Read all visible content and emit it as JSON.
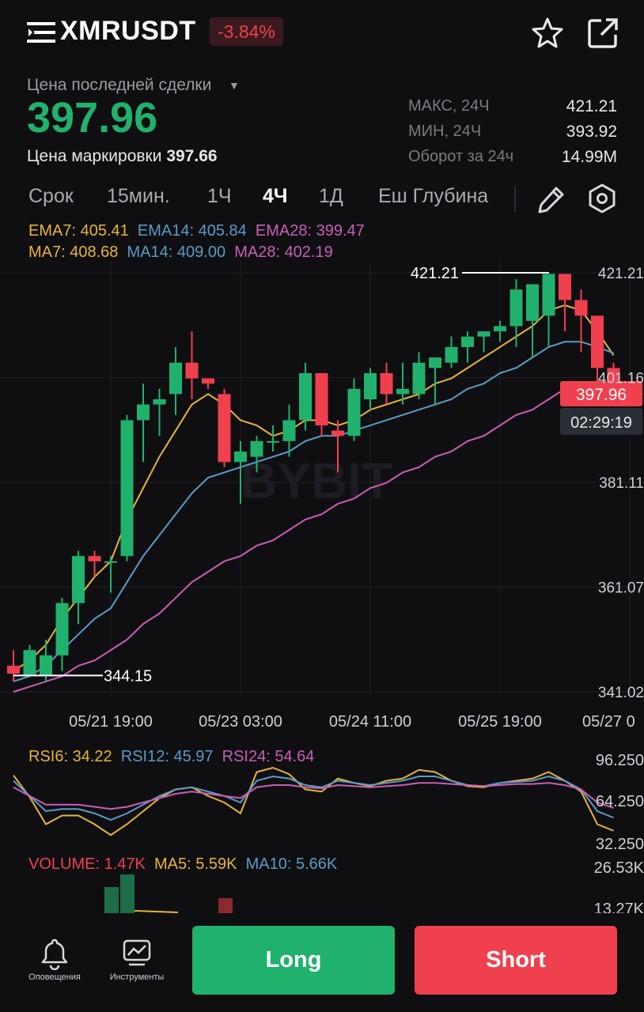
{
  "header": {
    "symbol": "XMRUSDT",
    "change": "-3.84%",
    "icons": [
      "menu-icon",
      "star-icon",
      "share-icon"
    ]
  },
  "price": {
    "label": "Цена последней сделки",
    "last": "397.96",
    "mark_label": "Цена маркировки",
    "mark_value": "397.66"
  },
  "stats": [
    {
      "label": "МАКС, 24Ч",
      "value": "421.21"
    },
    {
      "label": "МИН, 24Ч",
      "value": "393.92"
    },
    {
      "label": "Оборот за 24ч",
      "value": "14.99M"
    }
  ],
  "timeframes": [
    "Срок",
    "15мин.",
    "1Ч",
    "4Ч",
    "1Д",
    "Еш Глубина"
  ],
  "active_timeframe": "4Ч",
  "indicators": {
    "ema7": "EMA7: 405.41",
    "ema14": "EMA14: 405.84",
    "ema28": "EMA28: 399.47",
    "ma7": "MA7: 408.68",
    "ma14": "MA14: 409.00",
    "ma28": "MA28: 402.19"
  },
  "chart": {
    "y_ticks": [
      "421.21",
      "401.16",
      "381.11",
      "361.07",
      "341.02"
    ],
    "x_ticks": [
      "05/21 19:00",
      "05/23 03:00",
      "05/24 11:00",
      "05/25 19:00",
      "05/27 0"
    ],
    "high_marker": "421.21",
    "low_marker": "344.15",
    "current_price": "397.96",
    "countdown": "02:29:19",
    "watermark": "BYBIT"
  },
  "rsi": {
    "rsi6": "RSI6: 34.22",
    "rsi12": "RSI12: 45.97",
    "rsi24": "RSI24: 54.64",
    "ticks": [
      "96.250",
      "64.250",
      "32.250"
    ]
  },
  "volume": {
    "volume": "VOLUME: 1.47K",
    "ma5": "MA5: 5.59K",
    "ma10": "MA10: 5.66K",
    "ticks": [
      "26.53K",
      "13.27K"
    ]
  },
  "bottom": {
    "alerts": "Оповещения",
    "tools": "Инструменты",
    "long": "Long",
    "short": "Short"
  },
  "colors": {
    "up": "#20b26c",
    "down": "#f0404e",
    "ema7": "#e6b43a",
    "ema14": "#5b9bc6",
    "ema28": "#c95fb4"
  },
  "chart_data": {
    "type": "line",
    "x": [
      "05/21 19:00",
      "05/23 03:00",
      "05/24 11:00",
      "05/25 19:00",
      "05/27 0"
    ],
    "ylim": [
      341.02,
      421.21
    ],
    "candles": [
      {
        "o": 346,
        "h": 349,
        "l": 343,
        "c": 344.5
      },
      {
        "o": 344,
        "h": 350,
        "l": 344,
        "c": 349
      },
      {
        "o": 344,
        "h": 351,
        "l": 343,
        "c": 348
      },
      {
        "o": 348,
        "h": 359,
        "l": 345,
        "c": 358
      },
      {
        "o": 358,
        "h": 368,
        "l": 354,
        "c": 367
      },
      {
        "o": 367,
        "h": 368,
        "l": 363,
        "c": 366
      },
      {
        "o": 366,
        "h": 367,
        "l": 360,
        "c": 366
      },
      {
        "o": 367,
        "h": 394,
        "l": 366,
        "c": 393
      },
      {
        "o": 393,
        "h": 400,
        "l": 385,
        "c": 396
      },
      {
        "o": 396,
        "h": 399,
        "l": 390,
        "c": 397
      },
      {
        "o": 398,
        "h": 407,
        "l": 394,
        "c": 404
      },
      {
        "o": 404,
        "h": 410,
        "l": 397,
        "c": 401
      },
      {
        "o": 401,
        "h": 401,
        "l": 399,
        "c": 400
      },
      {
        "o": 398,
        "h": 399,
        "l": 384,
        "c": 385
      },
      {
        "o": 385,
        "h": 389,
        "l": 377,
        "c": 387
      },
      {
        "o": 386,
        "h": 390,
        "l": 383,
        "c": 389
      },
      {
        "o": 389,
        "h": 392,
        "l": 387,
        "c": 389
      },
      {
        "o": 389,
        "h": 396,
        "l": 386,
        "c": 393
      },
      {
        "o": 393,
        "h": 404,
        "l": 391,
        "c": 402
      },
      {
        "o": 402,
        "h": 402,
        "l": 390,
        "c": 392
      },
      {
        "o": 391,
        "h": 393,
        "l": 383,
        "c": 390
      },
      {
        "o": 390,
        "h": 401,
        "l": 389,
        "c": 399
      },
      {
        "o": 397,
        "h": 403,
        "l": 395,
        "c": 402
      },
      {
        "o": 402,
        "h": 404,
        "l": 396,
        "c": 398
      },
      {
        "o": 398,
        "h": 404,
        "l": 396,
        "c": 399
      },
      {
        "o": 398,
        "h": 406,
        "l": 397,
        "c": 404
      },
      {
        "o": 403,
        "h": 405,
        "l": 396,
        "c": 405
      },
      {
        "o": 404,
        "h": 409,
        "l": 403,
        "c": 407
      },
      {
        "o": 407,
        "h": 410,
        "l": 404,
        "c": 409
      },
      {
        "o": 409,
        "h": 410,
        "l": 406,
        "c": 410
      },
      {
        "o": 410,
        "h": 412,
        "l": 408,
        "c": 411
      },
      {
        "o": 411,
        "h": 420,
        "l": 407,
        "c": 418
      },
      {
        "o": 412,
        "h": 419,
        "l": 405,
        "c": 419
      },
      {
        "o": 413,
        "h": 421,
        "l": 407,
        "c": 421
      },
      {
        "o": 421,
        "h": 421,
        "l": 410,
        "c": 416
      },
      {
        "o": 416,
        "h": 418,
        "l": 406,
        "c": 413
      },
      {
        "o": 413,
        "h": 413,
        "l": 398,
        "c": 403
      },
      {
        "o": 403,
        "h": 404,
        "l": 397,
        "c": 397.96
      }
    ],
    "series": [
      {
        "name": "EMA7",
        "values": [
          345,
          347,
          350,
          355,
          359,
          363,
          366,
          374,
          380,
          386,
          391,
          396,
          398,
          396,
          393,
          392,
          390,
          391,
          393,
          393,
          392,
          393,
          395,
          396,
          397,
          398,
          400,
          401,
          403,
          405,
          407,
          409,
          411,
          414,
          415,
          414,
          410,
          405.41
        ]
      },
      {
        "name": "EMA14",
        "values": [
          343,
          344,
          346,
          349,
          352,
          355,
          357,
          362,
          367,
          371,
          375,
          379,
          382,
          383,
          384,
          385,
          386,
          387,
          389,
          390,
          390,
          391,
          392,
          393,
          394,
          395,
          396,
          397,
          399,
          400,
          402,
          403,
          405,
          407,
          408,
          408,
          407,
          405.84
        ]
      },
      {
        "name": "EMA28",
        "values": [
          341,
          342,
          343,
          344,
          346,
          347,
          349,
          351,
          354,
          356,
          359,
          362,
          364,
          366,
          367,
          369,
          370,
          372,
          374,
          375,
          377,
          378,
          380,
          381,
          383,
          384,
          386,
          387,
          389,
          390,
          392,
          394,
          395,
          397,
          399,
          400,
          400,
          399.47
        ]
      }
    ]
  }
}
